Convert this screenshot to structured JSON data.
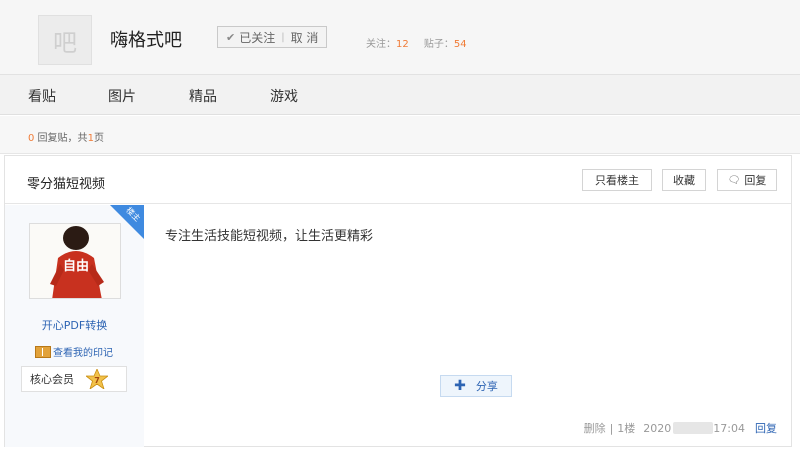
{
  "header": {
    "logo_text": "吧",
    "bar_name": "嗨格式吧",
    "follow": {
      "followed_label": "已关注",
      "separator": "|",
      "cancel_label": "取 消"
    },
    "stats": {
      "followers_label": "关注：",
      "followers": "12",
      "posts_label": "贴子：",
      "posts": "54"
    }
  },
  "nav": {
    "items": [
      "看贴",
      "图片",
      "精品",
      "游戏"
    ]
  },
  "reply_info": {
    "count": "0",
    "text_a": " 回复贴，共",
    "pages": "1",
    "text_b": "页"
  },
  "post": {
    "title": "零分猫短视频",
    "buttons": {
      "only_op": "只看楼主",
      "collect": "收藏",
      "reply": "回复"
    },
    "author": {
      "ribbon": "楼主",
      "avatar_text": "自由",
      "name": "开心PDF转换",
      "mark_link": "查看我的印记",
      "member_label": "核心会员",
      "level": "7"
    },
    "content": "专注生活技能短视频，让生活更精彩",
    "share_label": "分享",
    "footer": {
      "delete": "删除",
      "divider": "|",
      "floor": "1楼",
      "date_start": "2020",
      "time": "17:04",
      "reply": "回复"
    }
  },
  "colors": {
    "accent": "#f07c38",
    "link": "#2d64b3",
    "ribbon": "#3f8ae0"
  }
}
